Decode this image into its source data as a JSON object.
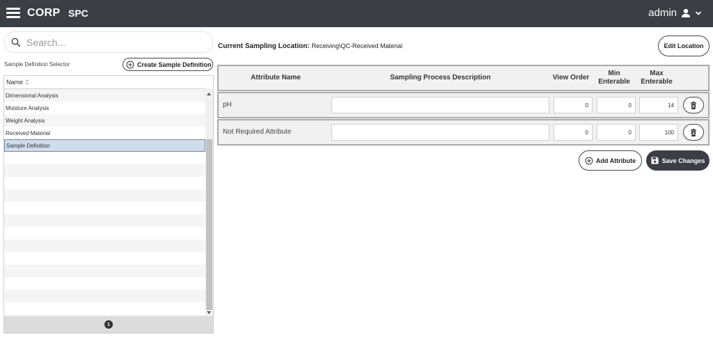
{
  "header": {
    "brand": "CORP",
    "app_name": "SPC",
    "user_name": "admin",
    "menu_icon": "hamburger-icon",
    "user_icon": "user-icon",
    "chevron_icon": "chevron-down-icon"
  },
  "sidebar": {
    "search_placeholder": "Search...",
    "selector_label": "Sample Definition Selector",
    "create_label": "Create Sample Definition",
    "column_header": "Name",
    "items": [
      {
        "label": "Dimensional Analysis"
      },
      {
        "label": "Moisture Analysis"
      },
      {
        "label": "Weight Analysis"
      },
      {
        "label": "Received Material"
      },
      {
        "label": "Sample Definition",
        "selected": true
      }
    ],
    "page_number": "1"
  },
  "main": {
    "location_label": "Current Sampling Location:",
    "location_value": "Receiving\\QC-Received Material",
    "edit_location_label": "Edit Location",
    "columns": {
      "attribute_name": "Attribute Name",
      "description": "Sampling Process Description",
      "view_order": "View Order",
      "min_enterable": "Min Enterable",
      "max_enterable": "Max Enterable"
    },
    "attributes": [
      {
        "name": "pH",
        "description": "",
        "view_order": "0",
        "min": "0",
        "max": "14"
      },
      {
        "name": "Not Required Attribute",
        "description": "",
        "view_order": "0",
        "min": "0",
        "max": "100"
      }
    ],
    "add_attribute_label": "Add Attribute",
    "save_changes_label": "Save Changes"
  },
  "colors": {
    "header_bg": "#3b3e45",
    "selected_row": "#cfdcec",
    "row_alt": "#f5f5f5"
  }
}
